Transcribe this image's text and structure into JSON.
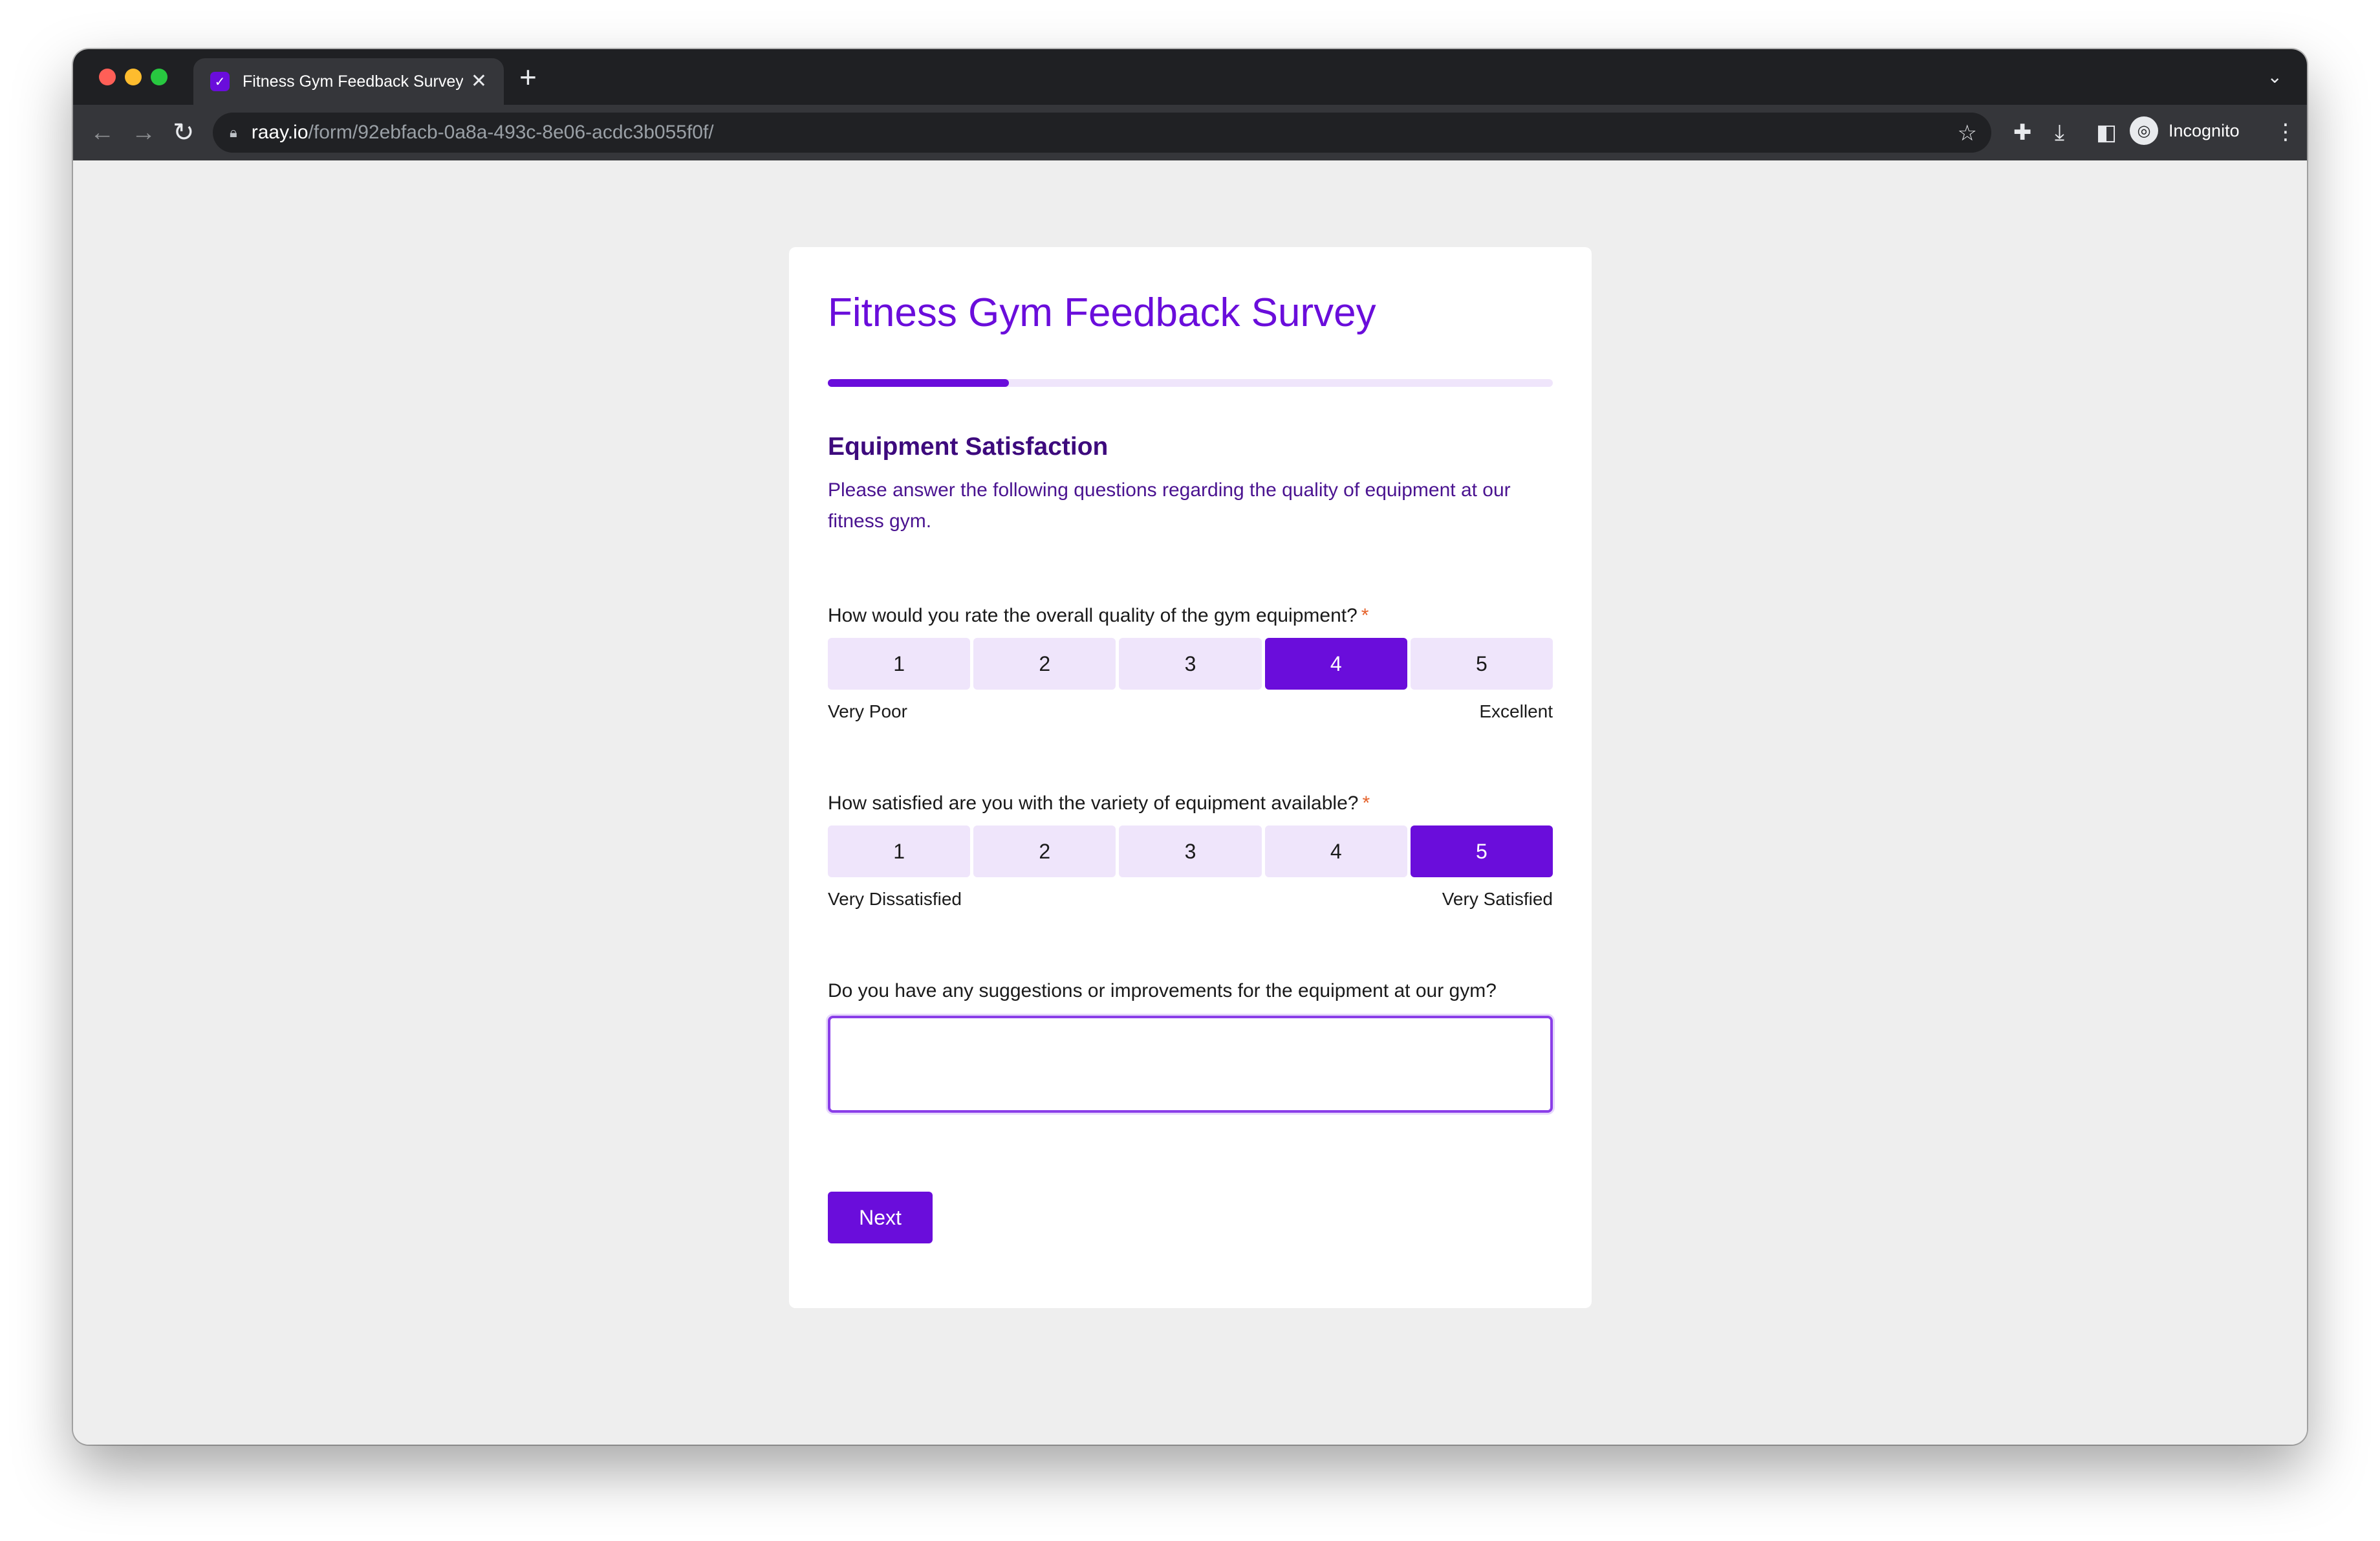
{
  "browser": {
    "tab_title": "Fitness Gym Feedback Survey",
    "tab_close": "✕",
    "new_tab": "+",
    "url_host": "raay.io",
    "url_path": "/form/92ebfacb-0a8a-493c-8e06-acdc3b055f0f/",
    "incognito_label": "Incognito",
    "icons": {
      "favicon": "check-icon",
      "back": "arrow-left-icon",
      "forward": "arrow-right-icon",
      "reload": "reload-icon",
      "lock": "lock-icon",
      "bookmark": "star-icon",
      "extensions": "puzzle-icon",
      "downloads": "download-icon",
      "side_panel": "side-panel-icon",
      "incognito": "incognito-icon",
      "menu": "kebab-icon",
      "tab_list": "chevron-down-icon"
    }
  },
  "survey": {
    "title": "Fitness Gym Feedback Survey",
    "progress_fraction": 0.25,
    "section_title": "Equipment Satisfaction",
    "section_description": "Please answer the following questions regarding the quality of equipment at our fitness gym.",
    "required_mark": "*",
    "questions": [
      {
        "label": "How would you rate the overall quality of the gym equipment?",
        "options": [
          "1",
          "2",
          "3",
          "4",
          "5"
        ],
        "selected": "4",
        "min_label": "Very Poor",
        "max_label": "Excellent"
      },
      {
        "label": "How satisfied are you with the variety of equipment available?",
        "options": [
          "1",
          "2",
          "3",
          "4",
          "5"
        ],
        "selected": "5",
        "min_label": "Very Dissatisfied",
        "max_label": "Very Satisfied"
      }
    ],
    "suggestion_label": "Do you have any suggestions or improvements for the equipment at our gym?",
    "suggestion_value": "",
    "next_label": "Next"
  },
  "colors": {
    "accent": "#6a0ddb",
    "scale_bg": "#efe5fb",
    "required": "#e5622b"
  }
}
